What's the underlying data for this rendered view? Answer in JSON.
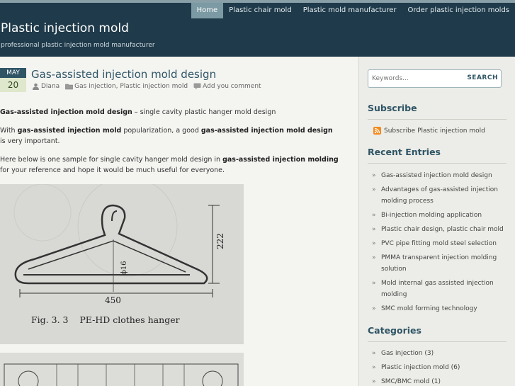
{
  "nav": {
    "items": [
      {
        "label": "Home",
        "active": true
      },
      {
        "label": "Plastic chair mold",
        "active": false
      },
      {
        "label": "Plastic mold manufacturer",
        "active": false
      },
      {
        "label": "Order plastic injection molds",
        "active": false
      }
    ]
  },
  "site": {
    "title": "Plastic injection mold",
    "description": "professional plastic injection mold manufacturer"
  },
  "post": {
    "date_month": "MAY",
    "date_day": "20",
    "title": "Gas-assisted injection mold design",
    "meta": {
      "author": "Diana",
      "categories": "Gas injection, Plastic injection mold",
      "comment": "Add you comment"
    },
    "para1": {
      "bold": "Gas-assisted injection mold design",
      "rest": " – single cavity plastic hanger mold design"
    },
    "para2": {
      "a": "With ",
      "b1": "gas-assisted injection mold",
      "c": " popularization, a good ",
      "b2": "gas-assisted injection mold design",
      "d": " is very important."
    },
    "para3": {
      "a": "Here below is one sample for single cavity hanger mold design in ",
      "b": "gas-assisted injection molding",
      "c": " for your reference and hope it would be much useful for everyone."
    },
    "figure1": {
      "dim_height": "222",
      "dim_width": "450",
      "dim_dia": "ϕ16",
      "caption": "Fig. 3. 3    PE-HD clothes hanger"
    }
  },
  "sidebar": {
    "search_placeholder": "Keywords...",
    "search_button": "SEARCH",
    "subscribe_title": "Subscribe",
    "subscribe_link": "Subscribe Plastic injection mold",
    "recent_title": "Recent Entries",
    "recent": [
      "Gas-assisted injection mold design",
      "Advantages of gas-assisted injection molding process",
      "Bi-injection molding application",
      "Plastic chair design, plastic chair mold",
      "PVC pipe fitting mold steel selection",
      "PMMA transparent injection molding solution",
      "Mold internal gas assisted injection molding",
      "SMC mold forming technology"
    ],
    "categories_title": "Categories",
    "categories": [
      {
        "name": "Gas injection",
        "count": "(3)"
      },
      {
        "name": "Plastic injection mold",
        "count": "(6)"
      },
      {
        "name": "SMC/BMC mold",
        "count": "(1)"
      }
    ]
  }
}
